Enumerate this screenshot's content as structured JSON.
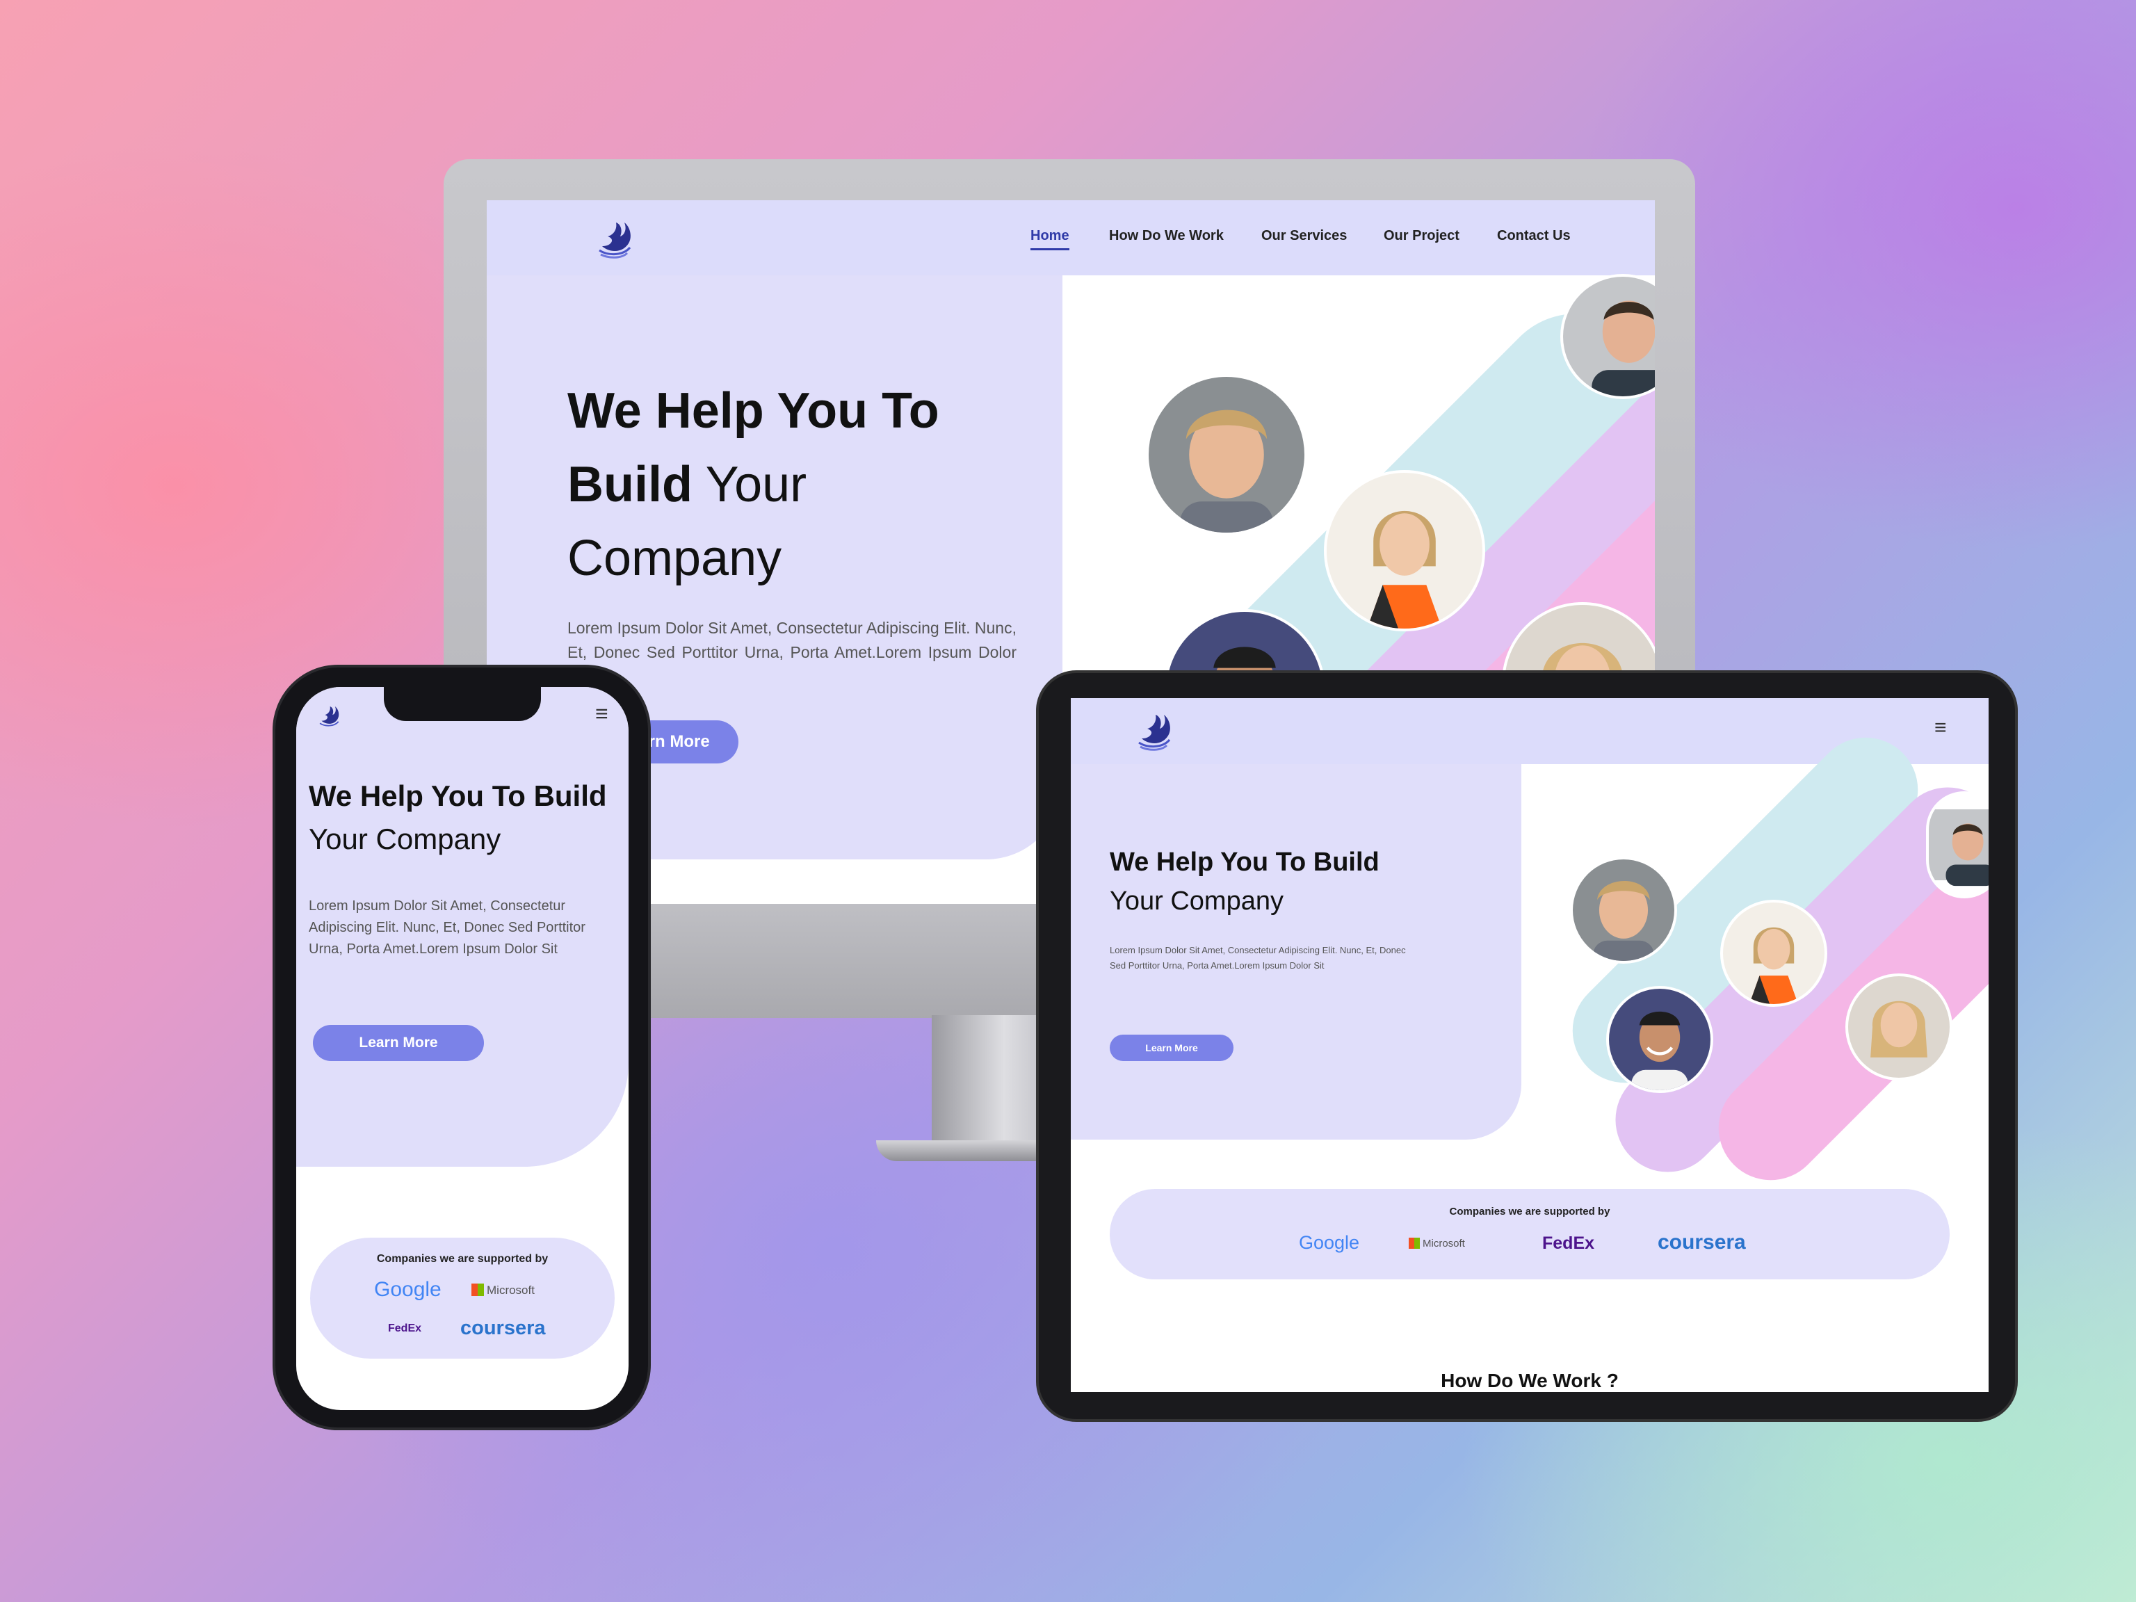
{
  "desktop": {
    "nav": {
      "items": [
        "Home",
        "How Do We Work",
        "Our Services",
        "Our Project",
        "Contact Us"
      ],
      "active": "Home"
    },
    "hero": {
      "title_line1": "We Help You To",
      "title_bold2": "Build",
      "title_rest2": "Your",
      "title_line3": "Company",
      "description": "Lorem Ipsum Dolor Sit Amet, Consectetur Adipiscing Elit. Nunc, Et, Donec Sed Porttitor Urna, Porta Amet.Lorem Ipsum Dolor Sit",
      "button": "Learn More"
    }
  },
  "phone": {
    "hero": {
      "title_line1": "We Help You To Build",
      "title_line2": "Your Company",
      "description": "Lorem Ipsum Dolor Sit Amet, Consectetur Adipiscing Elit. Nunc, Et, Donec Sed Porttitor Urna, Porta Amet.Lorem Ipsum Dolor Sit",
      "button": "Learn More"
    },
    "supporters": {
      "title": "Companies we are supported by",
      "brands": [
        "Google",
        "Microsoft",
        "FedEx",
        "coursera"
      ]
    }
  },
  "tablet": {
    "hero": {
      "title_line1": "We Help You To Build",
      "title_line2": "Your Company",
      "description": "Lorem Ipsum Dolor Sit Amet, Consectetur Adipiscing Elit. Nunc, Et, Donec Sed Porttitor Urna, Porta Amet.Lorem Ipsum Dolor Sit",
      "button": "Learn More"
    },
    "supporters": {
      "title": "Companies we are supported by",
      "brands": [
        "Google",
        "Microsoft",
        "FedEx",
        "coursera"
      ]
    },
    "section_heading": "How Do We Work ?"
  },
  "icons": {
    "logo": "eagle-logo-icon",
    "menu": "hamburger-menu-icon",
    "menu_glyph": "≡"
  },
  "colors": {
    "accent": "#7b82e8",
    "nav_bg": "#dcdcfb",
    "hero_bg": "#e0defa",
    "active_nav": "#2f3aa8",
    "stripe_blue": "#cfeaf0",
    "stripe_purple": "#e2c3f3",
    "stripe_pink": "#f5b6e6",
    "google_blue": "#4285f4",
    "fedex_purple": "#4d148c",
    "fedex_orange": "#ff6600",
    "coursera_blue": "#2a73cc"
  }
}
